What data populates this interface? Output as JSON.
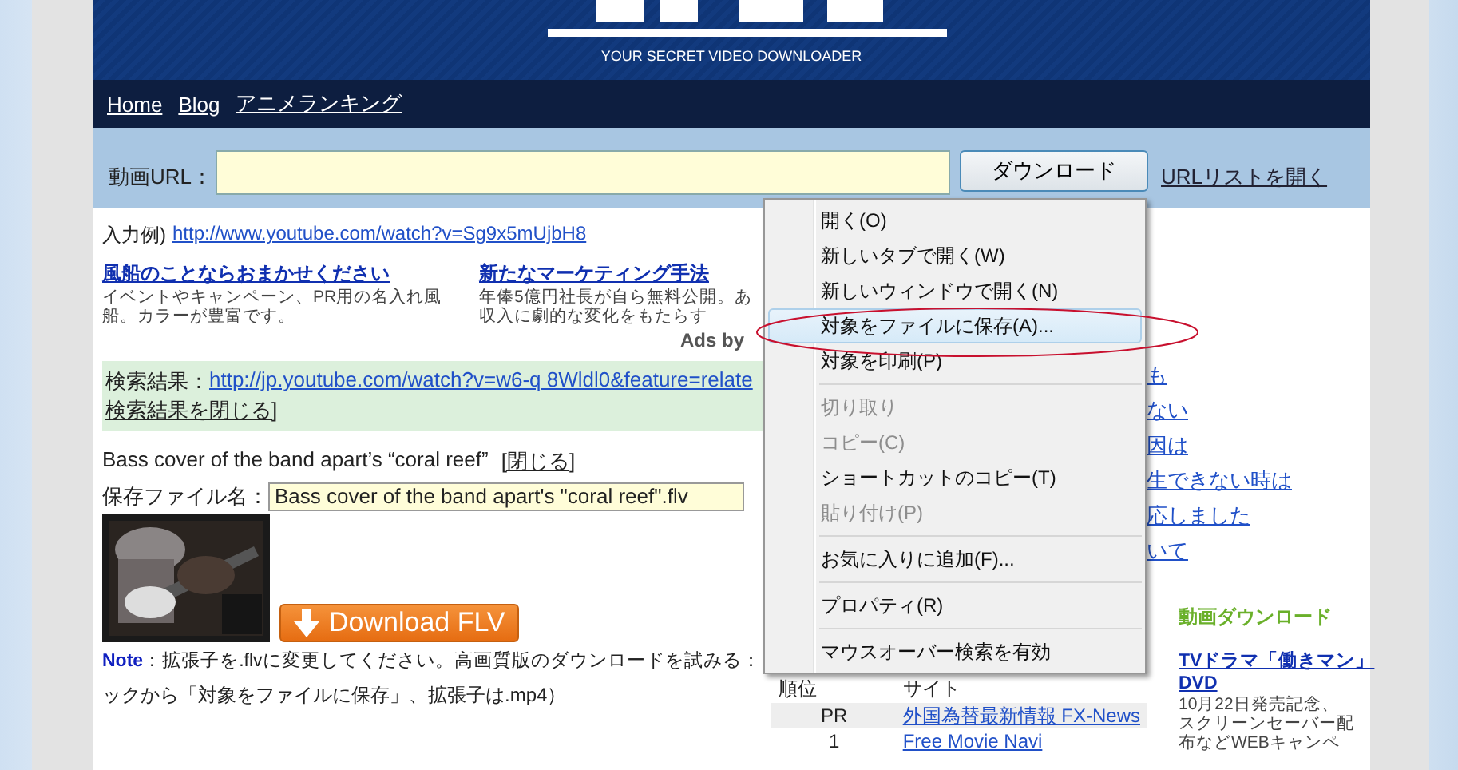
{
  "header": {
    "tagline": "YOUR SECRET VIDEO DOWNLOADER"
  },
  "nav": [
    {
      "label": "Home"
    },
    {
      "label": "Blog"
    },
    {
      "label": "アニメランキング"
    }
  ],
  "url_bar": {
    "label": "動画URL：",
    "download_button": "ダウンロード",
    "list_link": "URLリストを開く"
  },
  "example": {
    "label": "入力例)",
    "url": "http://www.youtube.com/watch?v=Sg9x5mUjbH8"
  },
  "ads": [
    {
      "title": "風船のことならおまかせください",
      "lines": [
        "イベントやキャンペーン、PR用の名入れ風",
        "船。カラーが豊富です。"
      ]
    },
    {
      "title": "新たなマーケティング手法",
      "lines": [
        "年俸5億円社長が自ら無料公開。あ",
        "収入に劇的な変化をもたらす"
      ]
    }
  ],
  "ads_by": "Ads by",
  "search_result": {
    "label": "検索結果：",
    "url": "http://jp.youtube.com/watch?v=w6-q 8Wldl0&feature=relate",
    "close": "検索結果を閉じる]"
  },
  "video": {
    "title": "Bass cover of the band apart’s “coral reef”",
    "close": "[閉じる]",
    "filename_label": "保存ファイル名：",
    "filename": "Bass cover of the band apart's \"coral reef\".flv",
    "download_button": "Download FLV"
  },
  "note": {
    "label": "Note",
    "text": "：拡張子を.flvに変更してください。高画質版のダウンロードを試みる：",
    "text_2": "ックから「対象をファイルに保存」、拡張子は.mp4）"
  },
  "ranking": {
    "columns": [
      "順位",
      "サイト"
    ],
    "rows": [
      {
        "rank": "PR",
        "site": "外国為替最新情報 FX-News"
      },
      {
        "rank": "1",
        "site": "Free Movie Navi"
      }
    ]
  },
  "side_links": [
    "も",
    "ない",
    "因は",
    "生できない時は",
    "応しました",
    "いて"
  ],
  "sidebar": {
    "heading": "動画ダウンロード",
    "ad_title": [
      "TVドラマ「働きマン」",
      "DVD"
    ],
    "ad_text": [
      "10月22日発売記念、",
      "スクリーンセーバー配",
      "布などWEBキャンペ"
    ]
  },
  "context_menu": [
    {
      "kind": "item",
      "label": "開く(O)",
      "disabled": false,
      "selected": false
    },
    {
      "kind": "item",
      "label": "新しいタブで開く(W)",
      "disabled": false,
      "selected": false
    },
    {
      "kind": "item",
      "label": "新しいウィンドウで開く(N)",
      "disabled": false,
      "selected": false
    },
    {
      "kind": "item",
      "label": "対象をファイルに保存(A)...",
      "disabled": false,
      "selected": true
    },
    {
      "kind": "item",
      "label": "対象を印刷(P)",
      "disabled": false,
      "selected": false
    },
    {
      "kind": "separator"
    },
    {
      "kind": "item",
      "label": "切り取り",
      "disabled": true,
      "selected": false
    },
    {
      "kind": "item",
      "label": "コピー(C)",
      "disabled": true,
      "selected": false
    },
    {
      "kind": "item",
      "label": "ショートカットのコピー(T)",
      "disabled": false,
      "selected": false
    },
    {
      "kind": "item",
      "label": "貼り付け(P)",
      "disabled": true,
      "selected": false
    },
    {
      "kind": "separator"
    },
    {
      "kind": "item",
      "label": "お気に入りに追加(F)...",
      "disabled": false,
      "selected": false
    },
    {
      "kind": "separator"
    },
    {
      "kind": "item",
      "label": "プロパティ(R)",
      "disabled": false,
      "selected": false
    },
    {
      "kind": "separator"
    },
    {
      "kind": "item",
      "label": "マウスオーバー検索を有効",
      "disabled": false,
      "selected": false
    }
  ]
}
